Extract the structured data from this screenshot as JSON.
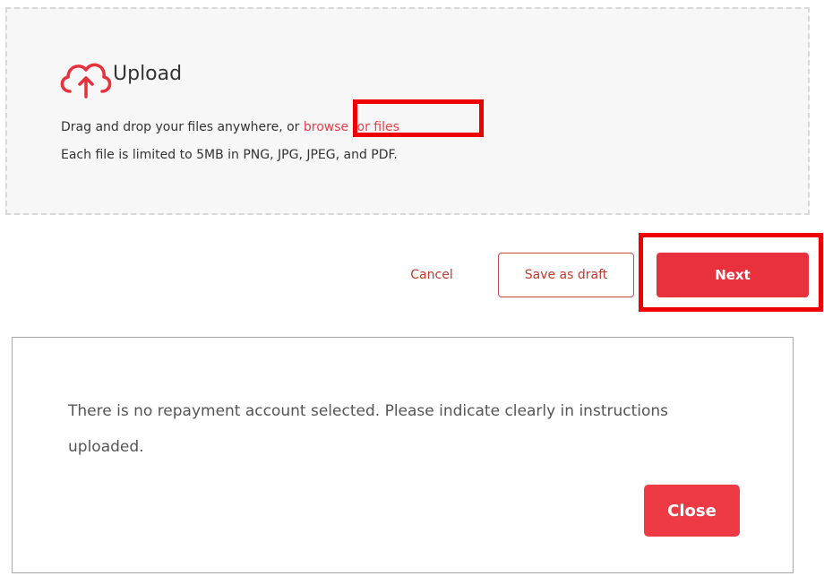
{
  "upload": {
    "icon": "cloud-upload-icon",
    "title": "Upload",
    "drag_text": "Drag and drop your files anywhere, or ",
    "browse_link": "browse for files",
    "limit_text": "Each file is limited to 5MB in PNG, JPG, JPEG, and PDF."
  },
  "actions": {
    "cancel_label": "Cancel",
    "draft_label": "Save as draft",
    "next_label": "Next"
  },
  "dialog": {
    "message": "There is no repayment account selected. Please indicate clearly in instructions uploaded.",
    "close_label": "Close"
  },
  "colors": {
    "accent": "#e8313d",
    "highlight": "#ee0000"
  }
}
